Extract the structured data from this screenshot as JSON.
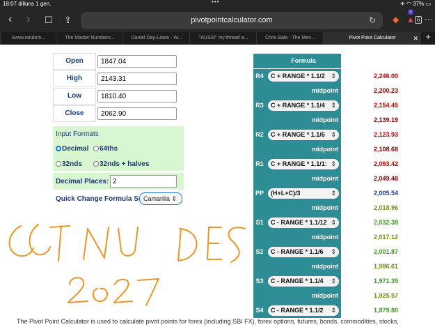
{
  "status_bar": {
    "time_date": "18:07  dilluns 1 gen.",
    "dots": "•••",
    "battery": "37%"
  },
  "browser": {
    "url": "pivotpointcalculator.com",
    "tabs": [
      {
        "label": "/www.random..."
      },
      {
        "label": "The Master Numbers..."
      },
      {
        "label": "Daniel Day-Lewis - W..."
      },
      {
        "label": "\"AUSSI\" my thread a..."
      },
      {
        "label": "Chris Bale - The Men..."
      },
      {
        "label": "Pivot Point Calculator",
        "active": true
      }
    ],
    "tab_count": "6",
    "badge": "7"
  },
  "inputs": [
    {
      "label": "Open",
      "value": "1847.04"
    },
    {
      "label": "High",
      "value": "2143.31"
    },
    {
      "label": "Low",
      "value": "1810.40"
    },
    {
      "label": "Close",
      "value": "2062.90"
    }
  ],
  "formats": {
    "header": "Input Formats",
    "options": [
      {
        "label": "Decimal",
        "selected": true
      },
      {
        "label": "64ths",
        "selected": false
      },
      {
        "label": "32nds",
        "selected": false
      },
      {
        "label": "32nds + halves",
        "selected": false
      }
    ]
  },
  "decimal_places": {
    "label": "Decimal Places:",
    "value": "2"
  },
  "quick_change": {
    "label": "Quick Change Formula Set:",
    "value": "Camarilla"
  },
  "pivot_table": {
    "header": "Formula",
    "rows": [
      {
        "tag": "R4",
        "formula": "C + RANGE * 1.1/2",
        "value": "2,246.00",
        "color": "#c00000"
      },
      {
        "tag": "",
        "formula": "midpoint",
        "value": "2,200.23",
        "color": "#800000",
        "mid": true
      },
      {
        "tag": "R3",
        "formula": "C + RANGE * 1.1/4",
        "value": "2,154.45",
        "color": "#c00000"
      },
      {
        "tag": "",
        "formula": "midpoint",
        "value": "2,139.19",
        "color": "#800000",
        "mid": true
      },
      {
        "tag": "R2",
        "formula": "C + RANGE * 1.1/6",
        "value": "2,123.93",
        "color": "#c00000"
      },
      {
        "tag": "",
        "formula": "midpoint",
        "value": "2,108.68",
        "color": "#800000",
        "mid": true
      },
      {
        "tag": "R1",
        "formula": "C + RANGE * 1.1/1:",
        "value": "2,093.42",
        "color": "#c00000"
      },
      {
        "tag": "",
        "formula": "midpoint",
        "value": "2,049.48",
        "color": "#800000",
        "mid": true
      },
      {
        "tag": "PP",
        "formula": "(H+L+C)/3",
        "value": "2,005.54",
        "color": "#1a3f9a"
      },
      {
        "tag": "",
        "formula": "midpoint",
        "value": "2,018.96",
        "color": "#7a8a1a",
        "mid": true
      },
      {
        "tag": "S1",
        "formula": "C - RANGE * 1.1/12",
        "value": "2,032.38",
        "color": "#3a9a1a"
      },
      {
        "tag": "",
        "formula": "midpoint",
        "value": "2,017.12",
        "color": "#7a8a1a",
        "mid": true
      },
      {
        "tag": "S2",
        "formula": "C - RANGE * 1.1/6",
        "value": "2,001.87",
        "color": "#3a9a1a"
      },
      {
        "tag": "",
        "formula": "midpoint",
        "value": "1,986.61",
        "color": "#7a8a1a",
        "mid": true
      },
      {
        "tag": "S3",
        "formula": "C - RANGE * 1.1/4",
        "value": "1,971.35",
        "color": "#3a9a1a"
      },
      {
        "tag": "",
        "formula": "midpoint",
        "value": "1,925.57",
        "color": "#7a8a1a",
        "mid": true
      },
      {
        "tag": "S4",
        "formula": "C - RANGE * 1.1/2",
        "value": "1,879.80",
        "color": "#3a9a1a"
      }
    ]
  },
  "description": "The Pivot Point Calculator is used to calculate pivot points for forex (including SBI FX), forex options, futures, bonds, commodities, stocks,",
  "colors": {
    "teal": "#2e8c94",
    "green_panel": "#d8f6d0",
    "handwriting": "#e8952a"
  }
}
